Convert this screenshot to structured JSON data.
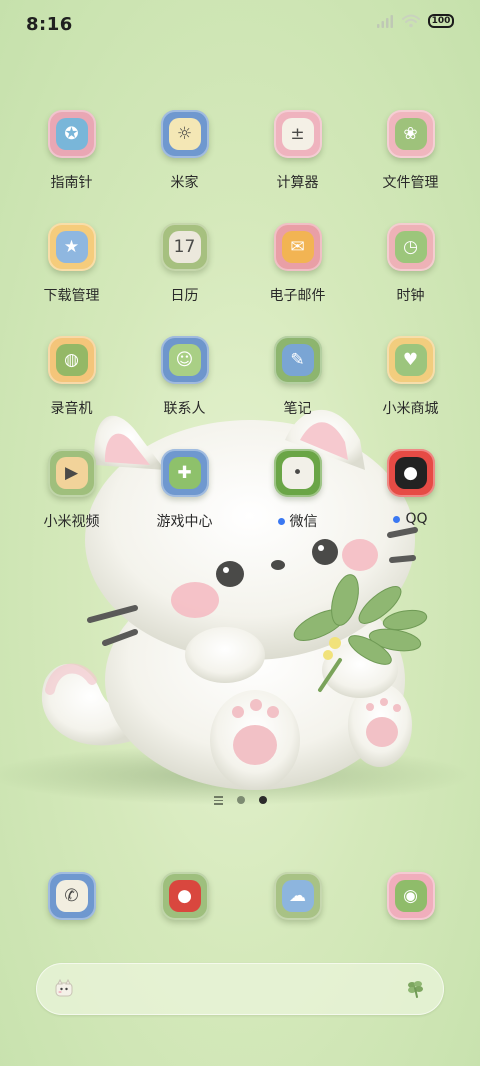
{
  "status_bar": {
    "time": "8:16",
    "battery": "100"
  },
  "apps": [
    {
      "label": "指南针",
      "icon": "compass-icon",
      "frame": "#e9a7b4",
      "inner": "#79b6d9",
      "glyph": "✪",
      "dot": false
    },
    {
      "label": "米家",
      "icon": "mi-home-bulb-icon",
      "frame": "#6f98cf",
      "inner": "#f4e7b5",
      "glyph": "☼",
      "dot": false
    },
    {
      "label": "计算器",
      "icon": "calculator-icon",
      "frame": "#efb3be",
      "inner": "#f4f0e6",
      "glyph": "±",
      "dot": false
    },
    {
      "label": "文件管理",
      "icon": "file-manager-icon",
      "frame": "#f0b6be",
      "inner": "#9ec27b",
      "glyph": "❀",
      "dot": false
    },
    {
      "label": "下载管理",
      "icon": "download-manager-icon",
      "frame": "#f5cc7c",
      "inner": "#8fb7e0",
      "glyph": "★",
      "dot": false
    },
    {
      "label": "日历",
      "icon": "calendar-icon",
      "frame": "#a6c07f",
      "inner": "#ece8dc",
      "glyph": "17",
      "dot": false
    },
    {
      "label": "电子邮件",
      "icon": "email-icon",
      "frame": "#e99fa6",
      "inner": "#f2b453",
      "glyph": "✉",
      "dot": false
    },
    {
      "label": "时钟",
      "icon": "clock-icon",
      "frame": "#eeb2b7",
      "inner": "#9cc67b",
      "glyph": "◷",
      "dot": false
    },
    {
      "label": "录音机",
      "icon": "recorder-icon",
      "frame": "#f4c57a",
      "inner": "#94b866",
      "glyph": "◍",
      "dot": false
    },
    {
      "label": "联系人",
      "icon": "contacts-icon",
      "frame": "#6e96cc",
      "inner": "#a9cf85",
      "glyph": "☺",
      "dot": false
    },
    {
      "label": "笔记",
      "icon": "notes-icon",
      "frame": "#8db56f",
      "inner": "#7aa5d4",
      "glyph": "✎",
      "dot": false
    },
    {
      "label": "小米商城",
      "icon": "mi-store-bag-icon",
      "frame": "#f2cd7e",
      "inner": "#9cc57d",
      "glyph": "♥",
      "dot": false
    },
    {
      "label": "小米视频",
      "icon": "mi-video-icon",
      "frame": "#9fbf7c",
      "inner": "#f2d39a",
      "glyph": "▶",
      "dot": false
    },
    {
      "label": "游戏中心",
      "icon": "game-center-icon",
      "frame": "#6f98cf",
      "inner": "#8ec16b",
      "glyph": "✚",
      "dot": false
    },
    {
      "label": "微信",
      "icon": "wechat-icon",
      "frame": "#6aa546",
      "inner": "#f2f0e8",
      "glyph": "•",
      "dot": true
    },
    {
      "label": "QQ",
      "icon": "qq-penguin-icon",
      "frame": "#e64b45",
      "inner": "#222222",
      "glyph": "●",
      "dot": true
    }
  ],
  "dock": [
    {
      "icon": "phone-icon",
      "frame": "#6f98cf",
      "inner": "#f2eee0",
      "glyph": "✆"
    },
    {
      "icon": "messages-apple-icon",
      "frame": "#9ebf7d",
      "inner": "#d9473e",
      "glyph": "●"
    },
    {
      "icon": "browser-icon",
      "frame": "#a8c285",
      "inner": "#8db5de",
      "glyph": "☁"
    },
    {
      "icon": "camera-icon",
      "frame": "#f0aebc",
      "inner": "#8fbc6a",
      "glyph": "◉"
    }
  ],
  "page_indicator": {
    "active_index": 2
  }
}
